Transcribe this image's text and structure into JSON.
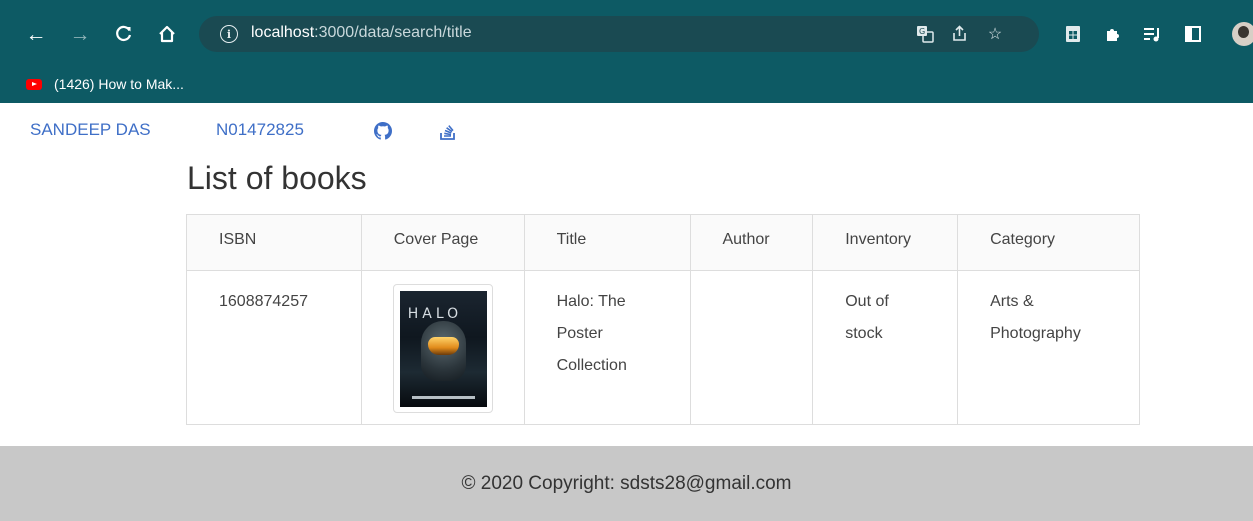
{
  "browser": {
    "url_host": "localhost",
    "url_path": ":3000/data/search/title",
    "bookmark_label": "(1426) How to Mak..."
  },
  "nav": {
    "name": "SANDEEP DAS",
    "student_id": "N01472825"
  },
  "page": {
    "heading": "List of books"
  },
  "table": {
    "headers": [
      "ISBN",
      "Cover Page",
      "Title",
      "Author",
      "Inventory",
      "Category"
    ],
    "rows": [
      {
        "isbn": "1608874257",
        "cover_text": "HALO",
        "title": "Halo: The Poster Collection",
        "author": "",
        "inventory": "Out of stock",
        "category": "Arts & Photography"
      }
    ]
  },
  "footer": {
    "text": "© 2020 Copyright: sdsts28@gmail.com"
  },
  "colors": {
    "chrome_bg": "#0d5a64",
    "link": "#3f6fc7",
    "footer_bg": "#c8c8c8"
  }
}
